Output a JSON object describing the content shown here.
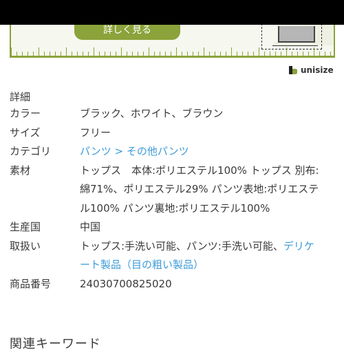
{
  "banner": {
    "button_label": "詳しく見る"
  },
  "brand": {
    "name": "unisize"
  },
  "details": {
    "title": "詳細",
    "rows": [
      {
        "label": "カラー",
        "value": "ブラック、ホワイト、ブラウン"
      },
      {
        "label": "サイズ",
        "value": "フリー"
      },
      {
        "label": "カテゴリ",
        "link_1": "パンツ",
        "separator": " > ",
        "link_2": "その他パンツ"
      },
      {
        "label": "素材",
        "line_1": "トップス　本体:ポリエステル100% トップス 別布:",
        "line_2": "綿71%、ポリエステル29% パンツ表地:ポリエステ",
        "line_3": "ル100% パンツ裏地:ポリエステル100%"
      },
      {
        "label": "生産国",
        "value": "中国"
      },
      {
        "label": "取扱い",
        "text_1": "トップス:手洗い可能、パンツ:手洗い可能、",
        "link_1": "デリケ",
        "link_2": "ート製品（目の粗い製品）"
      },
      {
        "label": "商品番号",
        "value": "24030700825020"
      }
    ]
  },
  "footer": {
    "partial_heading": "関連キーワード"
  }
}
